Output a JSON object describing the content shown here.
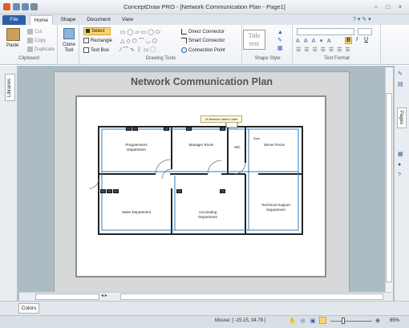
{
  "window": {
    "title": "ConceptDraw PRO - [Network Communication Plan - Page1]",
    "controls": {
      "minimize": "–",
      "maximize": "□",
      "close": "×"
    }
  },
  "tabs": [
    "File",
    "Home",
    "Shape",
    "Document",
    "View"
  ],
  "ribbon": {
    "clipboard": {
      "paste": "Paste",
      "cut": "Cut",
      "copy": "Copy",
      "duplicate": "Duplicate",
      "label": "Clipboard"
    },
    "clone": {
      "label": "Clone Tool"
    },
    "drawing": {
      "select": "Select",
      "rectangle": "Rectangle",
      "textbox": "Text Box",
      "label": "Drawing Tools"
    },
    "connectors": {
      "direct": "Direct Connector",
      "smart": "Smart Connector",
      "point": "Connection Point"
    },
    "shapestyle": {
      "sample": "Title text",
      "label": "Shape Style"
    },
    "textformat": {
      "label": "Text Format"
    }
  },
  "sidebar": {
    "libraries": "Libraries",
    "pages": "Pages"
  },
  "document": {
    "title": "Network Communication Plan",
    "callout": "25 Network Cables Cable",
    "rooms": {
      "programmers": "Programmers Department",
      "manager": "Manager Room",
      "wc": "WC",
      "server": "Server Room",
      "sales": "Sales Department",
      "accounting": "Accounting Department",
      "technical": "Technical Support Department",
      "rack": "Rack"
    }
  },
  "colors_tab": "Colors",
  "status": {
    "mouse": "Mouse: [ -15.15, 34.79 ]",
    "zoom": "65%"
  },
  "colors": {
    "accent": "#2c5fa8",
    "cable": "#2f7fc1"
  }
}
